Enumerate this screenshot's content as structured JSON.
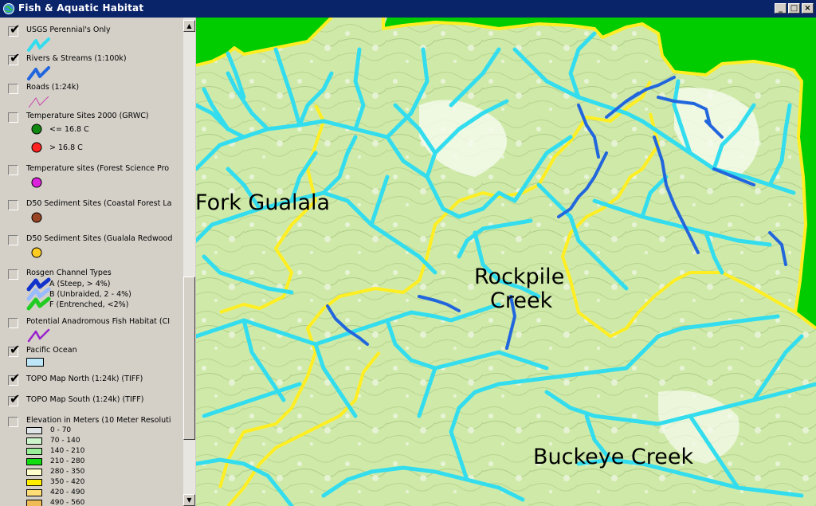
{
  "window": {
    "title": "Fish & Aquatic Habitat",
    "min": "_",
    "max": "□",
    "close": "×"
  },
  "legend": {
    "layers": [
      {
        "label": "USGS Perennial's Only",
        "checked": true
      },
      {
        "label": "Rivers & Streams (1:100k)",
        "checked": true
      },
      {
        "label": "Roads (1:24k)",
        "checked": false
      },
      {
        "label": "Temperature Sites 2000 (GRWC)",
        "checked": false,
        "classes": [
          "<= 16.8 C",
          "> 16.8 C"
        ]
      },
      {
        "label": "Temperature sites (Forest Science Pro",
        "checked": false
      },
      {
        "label": "D50 Sediment Sites (Coastal Forest La",
        "checked": false
      },
      {
        "label": "D50 Sediment Sites (Gualala Redwood",
        "checked": false
      },
      {
        "label": "Rosgen Channel Types",
        "checked": false,
        "classes": [
          "A  (Steep, > 4%)",
          "B  (Unbraided, 2 - 4%)",
          "F  (Entrenched, <2%)"
        ]
      },
      {
        "label": "Potential Anadromous Fish Habitat (CI",
        "checked": false
      },
      {
        "label": "Pacific Ocean",
        "checked": true
      },
      {
        "label": "TOPO Map North (1:24k) (TIFF)",
        "checked": true
      },
      {
        "label": "TOPO Map South (1:24k) (TIFF)",
        "checked": true
      },
      {
        "label": "Elevation in Meters (10 Meter Resoluti",
        "checked": false,
        "classes": [
          "0 - 70",
          "70 - 140",
          "140 - 210",
          "210 - 280",
          "280 - 350",
          "350 - 420",
          "420 - 490",
          "490 - 560"
        ]
      }
    ]
  },
  "map": {
    "labels": [
      "Fork Gualala",
      "Rockpile",
      "Creek",
      "Buckeye Creek"
    ]
  },
  "colors": {
    "titlebar": "#0a246a",
    "perennial": "#33ddee",
    "rivers": "#2266dd",
    "watershed_boundary": "#ffee22",
    "ocean_fill": "#00cc00",
    "topo": "#cfeaa8"
  }
}
